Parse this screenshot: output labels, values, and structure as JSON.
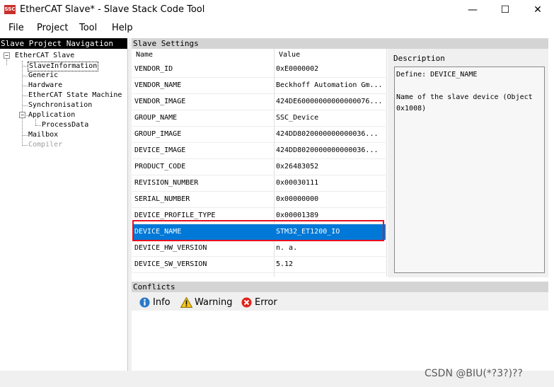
{
  "window": {
    "title": "EtherCAT Slave* - Slave Stack Code Tool",
    "app_icon_text": "SSC",
    "minimize_glyph": "—",
    "maximize_glyph": "☐",
    "close_glyph": "✕"
  },
  "menu": [
    "File",
    "Project",
    "Tool",
    "Help"
  ],
  "navigation": {
    "header": "Slave Project Navigation",
    "root": "EtherCAT Slave",
    "items": [
      "SlaveInformation",
      "Generic",
      "Hardware",
      "EtherCAT State Machine",
      "Synchronisation",
      "Application",
      "ProcessData",
      "Mailbox",
      "Compiler"
    ],
    "selected": "SlaveInformation",
    "disabled": "Compiler"
  },
  "settings": {
    "header": "Slave Settings",
    "col_name": "Name",
    "col_value": "Value",
    "rows": [
      {
        "name": "VENDOR_ID",
        "value": "0xE0000002"
      },
      {
        "name": "VENDOR_NAME",
        "value": "Beckhoff Automation Gm..."
      },
      {
        "name": "VENDOR_IMAGE",
        "value": "424DE60000000000000076..."
      },
      {
        "name": "GROUP_NAME",
        "value": "SSC_Device"
      },
      {
        "name": "GROUP_IMAGE",
        "value": "424DD8020000000000036..."
      },
      {
        "name": "DEVICE_IMAGE",
        "value": "424DD8020000000000036..."
      },
      {
        "name": "PRODUCT_CODE",
        "value": "0x26483052"
      },
      {
        "name": "REVISION_NUMBER",
        "value": "0x00030111"
      },
      {
        "name": "SERIAL_NUMBER",
        "value": "0x00000000"
      },
      {
        "name": "DEVICE_PROFILE_TYPE",
        "value": "0x00001389"
      },
      {
        "name": "DEVICE_NAME",
        "value": "STM32_ET1200_IO"
      },
      {
        "name": "DEVICE_HW_VERSION",
        "value": "n. a."
      },
      {
        "name": "DEVICE_SW_VERSION",
        "value": "5.12"
      }
    ],
    "selected_row": "DEVICE_NAME"
  },
  "description": {
    "title": "Description",
    "text": "Define: DEVICE_NAME\n\nName of the slave device (Object\n0x1008)"
  },
  "conflicts": {
    "header": "Conflicts",
    "info_label": "Info",
    "warning_label": "Warning",
    "error_label": "Error"
  },
  "watermark": "CSDN @BIU(*?3?)??"
}
